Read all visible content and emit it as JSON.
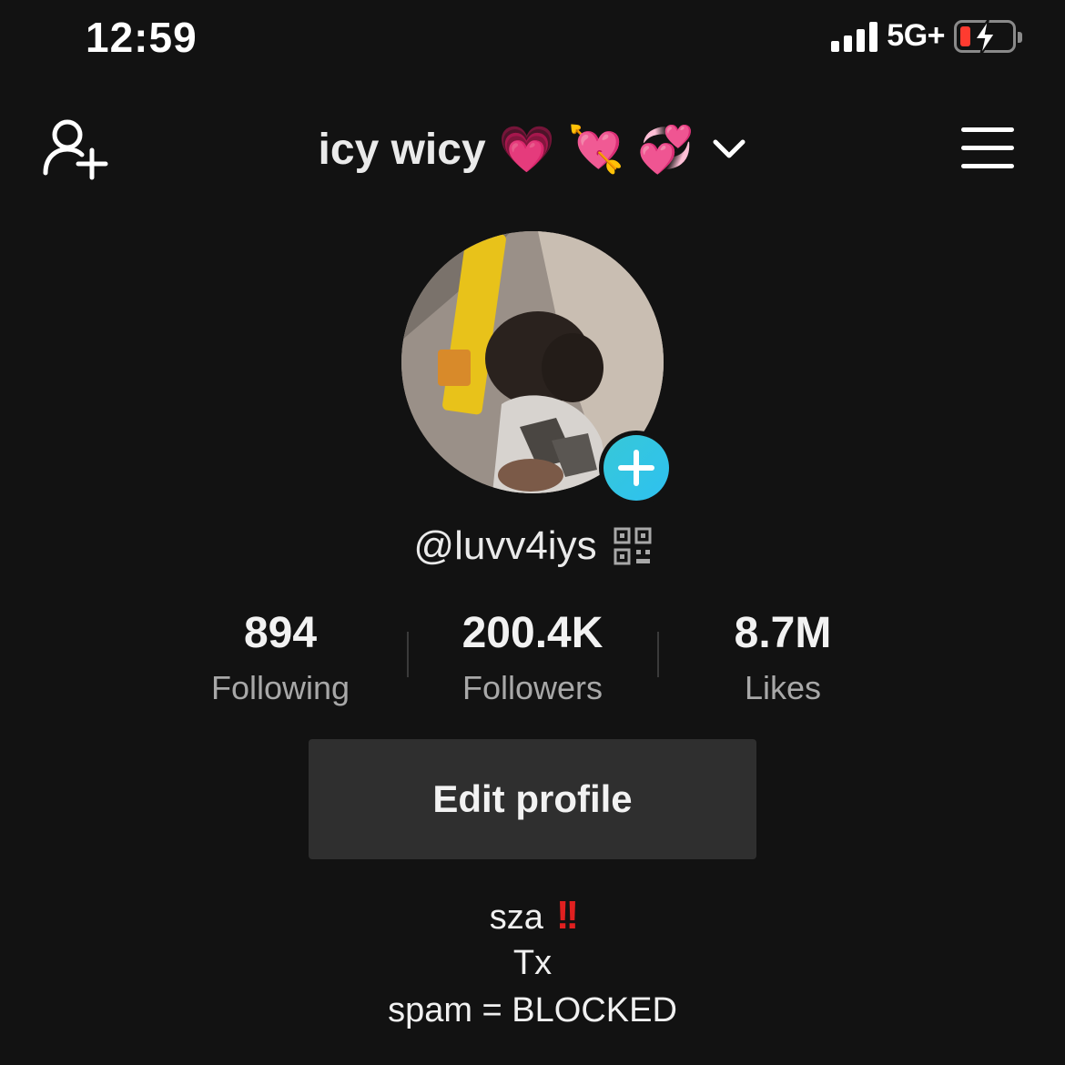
{
  "status_bar": {
    "time": "12:59",
    "network": "5G+",
    "battery_level_percent": 10,
    "charging": true
  },
  "header": {
    "account_name": "icy wicy",
    "emojis": [
      "💗",
      "💘",
      "💞"
    ],
    "icons": [
      "add-user-icon",
      "chevron-down-icon",
      "menu-icon"
    ]
  },
  "profile": {
    "username": "@luvv4iys",
    "avatar_badge_icon": "plus-icon",
    "qr_icon": "qr-code-icon"
  },
  "stats": [
    {
      "value": "894",
      "label": "Following"
    },
    {
      "value": "200.4K",
      "label": "Followers"
    },
    {
      "value": "8.7M",
      "label": "Likes"
    }
  ],
  "edit_profile_label": "Edit profile",
  "bio": {
    "line1_text": "sza",
    "line1_emoji": "!!",
    "line2": "Tx",
    "line3": "spam = BLOCKED"
  },
  "colors": {
    "background": "#121212",
    "button_bg": "#2f2f2f",
    "muted_text": "#a8a8a8",
    "accent_teal": "#37c8d8",
    "battery_red": "#ff3b30",
    "exclaim_red": "#e02020"
  }
}
